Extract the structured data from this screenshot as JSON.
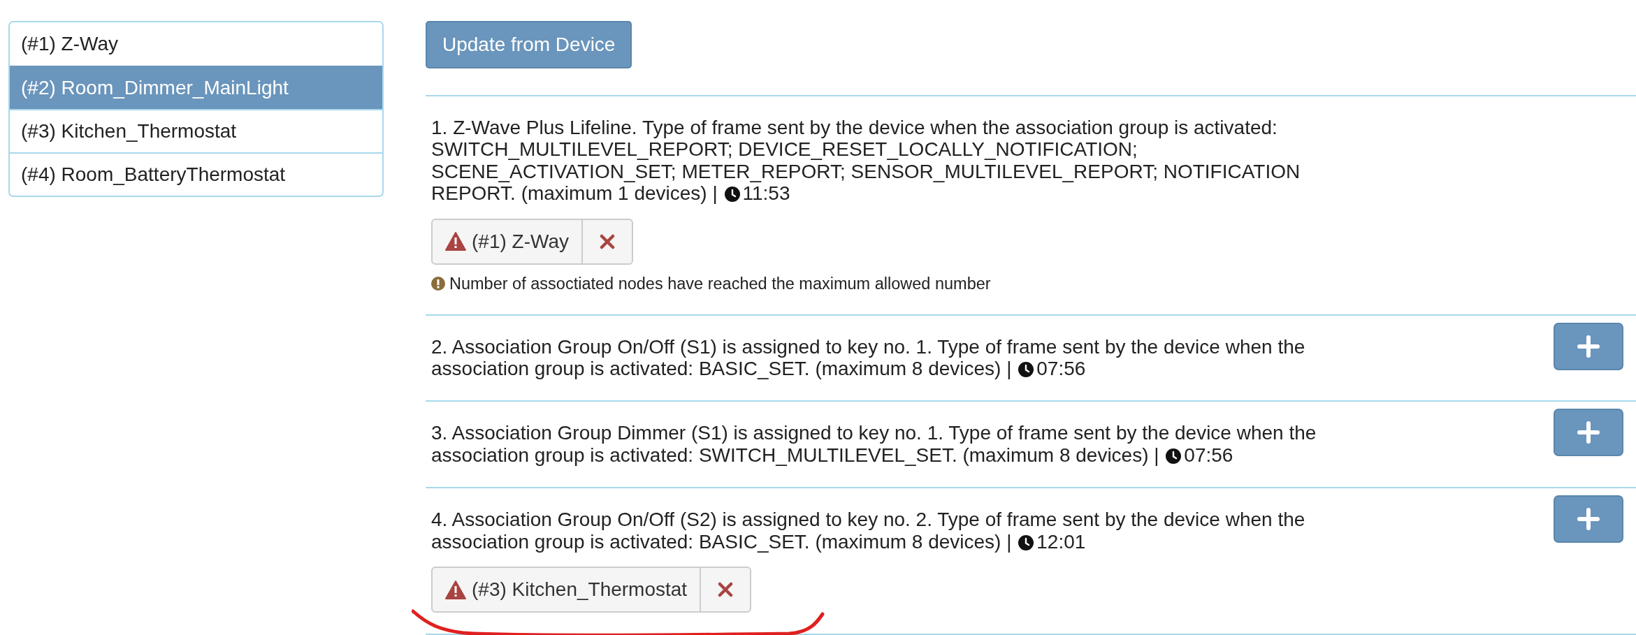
{
  "devices": [
    {
      "label": "(#1) Z-Way",
      "selected": false
    },
    {
      "label": "(#2) Room_Dimmer_MainLight",
      "selected": true
    },
    {
      "label": "(#3) Kitchen_Thermostat",
      "selected": false
    },
    {
      "label": "(#4) Room_BatteryThermostat",
      "selected": false
    }
  ],
  "update_button": "Update from Device",
  "groups": [
    {
      "text": "1. Z-Wave Plus Lifeline. Type of frame sent by the device when the association group is activated: SWITCH_MULTILEVEL_REPORT; DEVICE_RESET_LOCALLY_NOTIFICATION; SCENE_ACTIVATION_SET; METER_REPORT; SENSOR_MULTILEVEL_REPORT; NOTIFICATION REPORT. (maximum 1 devices) |",
      "time": "11:53",
      "can_add": false,
      "nodes": [
        {
          "label": "(#1) Z-Way",
          "warning": true
        }
      ],
      "notice": "Number of assoctiated nodes have reached the maximum allowed number",
      "underlined": false
    },
    {
      "text": "2. Association Group On/Off (S1) is assigned to key no. 1. Type of frame sent by the device when the association group is activated: BASIC_SET. (maximum 8 devices) |",
      "time": "07:56",
      "can_add": true,
      "underlined": false
    },
    {
      "text": "3. Association Group Dimmer (S1) is assigned to key no. 1. Type of frame sent by the device when the association group is activated: SWITCH_MULTILEVEL_SET. (maximum 8 devices) |",
      "time": "07:56",
      "can_add": true,
      "underlined": false
    },
    {
      "text": "4. Association Group On/Off (S2) is assigned to key no. 2. Type of frame sent by the device when the association group is activated: BASIC_SET. (maximum 8 devices) |",
      "time": "12:01",
      "can_add": true,
      "nodes": [
        {
          "label": "(#3) Kitchen_Thermostat",
          "warning": true
        }
      ],
      "underlined": true
    }
  ]
}
